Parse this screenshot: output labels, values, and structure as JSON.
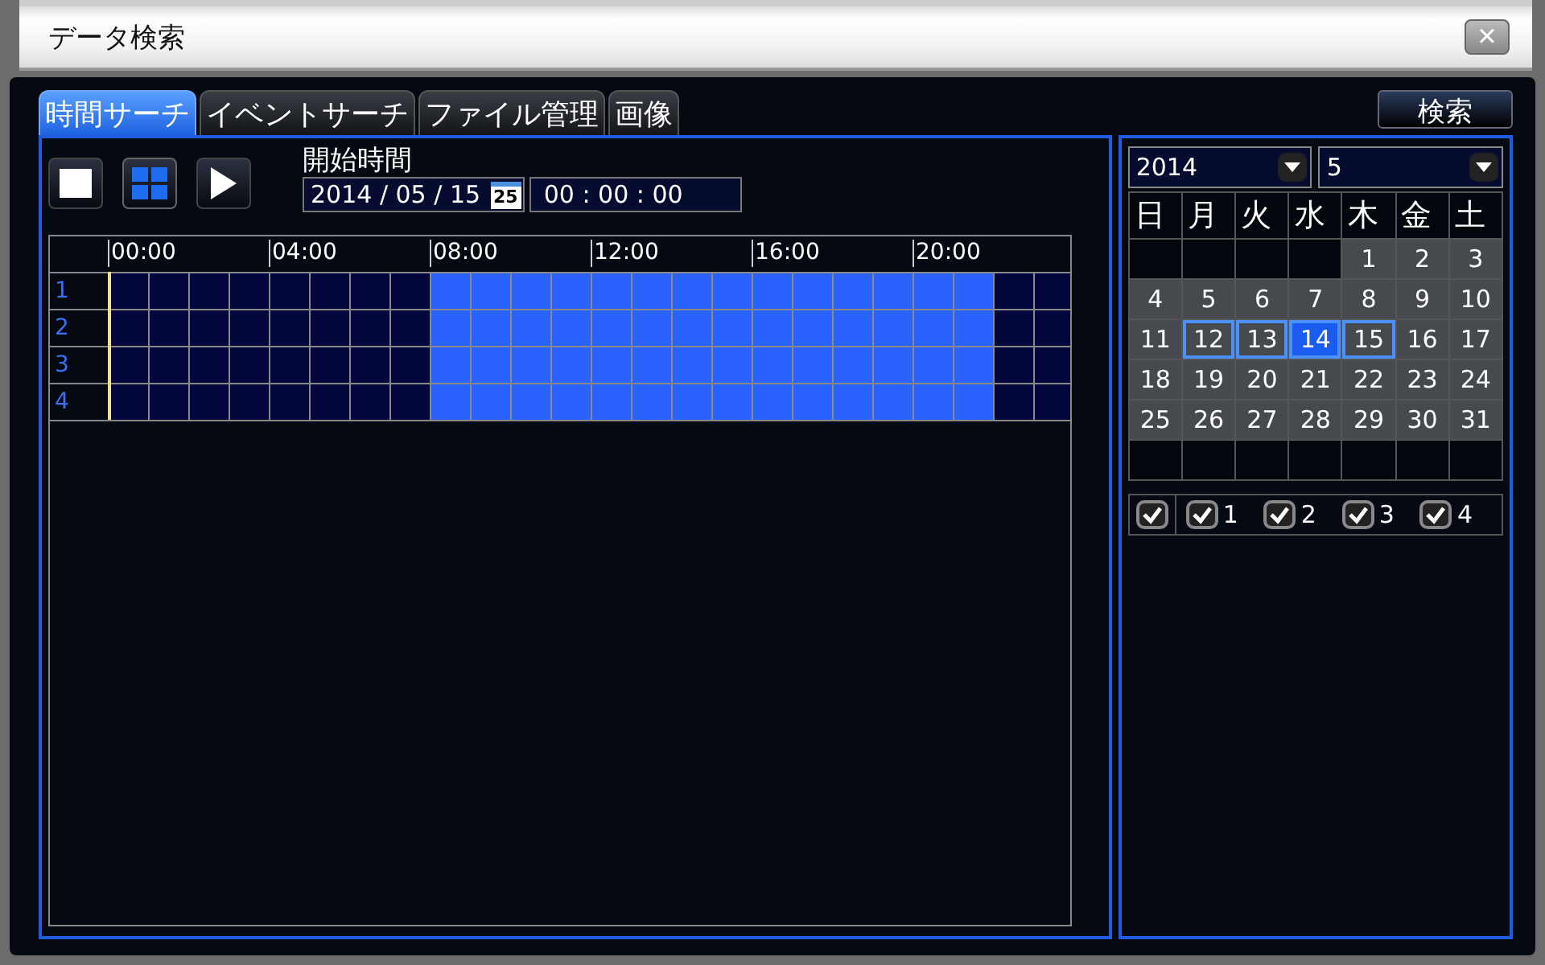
{
  "window": {
    "title": "データ検索",
    "close": "×"
  },
  "tabs": [
    {
      "label": "時間サーチ",
      "selected": true
    },
    {
      "label": "イベントサーチ",
      "selected": false
    },
    {
      "label": "ファイル管理",
      "selected": false
    },
    {
      "label": "画像",
      "selected": false
    }
  ],
  "search_button": "検索",
  "view_buttons": [
    {
      "kind": "single",
      "selected": false
    },
    {
      "kind": "quad",
      "selected": true
    },
    {
      "kind": "play",
      "selected": false
    }
  ],
  "start_time": {
    "label": "開始時間",
    "date": "2014 / 05 / 15",
    "calendar_icon": "25",
    "time": "00 : 00 : 00"
  },
  "timeline": {
    "ticks": [
      "00:00",
      "04:00",
      "08:00",
      "12:00",
      "16:00",
      "20:00"
    ],
    "channels": [
      {
        "label": "1",
        "recorded_hours": [
          false,
          false,
          false,
          false,
          false,
          false,
          false,
          false,
          true,
          true,
          true,
          true,
          true,
          true,
          true,
          true,
          true,
          true,
          true,
          true,
          true,
          true,
          false,
          false
        ]
      },
      {
        "label": "2",
        "recorded_hours": [
          false,
          false,
          false,
          false,
          false,
          false,
          false,
          false,
          true,
          true,
          true,
          true,
          true,
          true,
          true,
          true,
          true,
          true,
          true,
          true,
          true,
          true,
          false,
          false
        ]
      },
      {
        "label": "3",
        "recorded_hours": [
          false,
          false,
          false,
          false,
          false,
          false,
          false,
          false,
          true,
          true,
          true,
          true,
          true,
          true,
          true,
          true,
          true,
          true,
          true,
          true,
          true,
          true,
          false,
          false
        ]
      },
      {
        "label": "4",
        "recorded_hours": [
          false,
          false,
          false,
          false,
          false,
          false,
          false,
          false,
          true,
          true,
          true,
          true,
          true,
          true,
          true,
          true,
          true,
          true,
          true,
          true,
          true,
          true,
          false,
          false
        ]
      }
    ]
  },
  "calendar": {
    "year": "2014",
    "month": "5",
    "weekdays": [
      "日",
      "月",
      "火",
      "水",
      "木",
      "金",
      "土"
    ],
    "days": [
      {
        "label": "1",
        "recorded": true,
        "marked": false,
        "selected": false
      },
      {
        "label": "2",
        "recorded": true,
        "marked": false,
        "selected": false
      },
      {
        "label": "3",
        "recorded": true,
        "marked": false,
        "selected": false
      },
      {
        "label": "4",
        "recorded": true,
        "marked": false,
        "selected": false
      },
      {
        "label": "5",
        "recorded": true,
        "marked": false,
        "selected": false
      },
      {
        "label": "6",
        "recorded": true,
        "marked": false,
        "selected": false
      },
      {
        "label": "7",
        "recorded": true,
        "marked": false,
        "selected": false
      },
      {
        "label": "8",
        "recorded": true,
        "marked": false,
        "selected": false
      },
      {
        "label": "9",
        "recorded": true,
        "marked": false,
        "selected": false
      },
      {
        "label": "10",
        "recorded": true,
        "marked": false,
        "selected": false
      },
      {
        "label": "11",
        "recorded": true,
        "marked": false,
        "selected": false
      },
      {
        "label": "12",
        "recorded": true,
        "marked": true,
        "selected": false
      },
      {
        "label": "13",
        "recorded": true,
        "marked": true,
        "selected": false
      },
      {
        "label": "14",
        "recorded": true,
        "marked": true,
        "selected": true
      },
      {
        "label": "15",
        "recorded": true,
        "marked": true,
        "selected": false
      },
      {
        "label": "16",
        "recorded": true,
        "marked": false,
        "selected": false
      },
      {
        "label": "17",
        "recorded": true,
        "marked": false,
        "selected": false
      },
      {
        "label": "18",
        "recorded": true,
        "marked": false,
        "selected": false
      },
      {
        "label": "19",
        "recorded": true,
        "marked": false,
        "selected": false
      },
      {
        "label": "20",
        "recorded": true,
        "marked": false,
        "selected": false
      },
      {
        "label": "21",
        "recorded": true,
        "marked": false,
        "selected": false
      },
      {
        "label": "22",
        "recorded": true,
        "marked": false,
        "selected": false
      },
      {
        "label": "23",
        "recorded": true,
        "marked": false,
        "selected": false
      },
      {
        "label": "24",
        "recorded": true,
        "marked": false,
        "selected": false
      },
      {
        "label": "25",
        "recorded": true,
        "marked": false,
        "selected": false
      },
      {
        "label": "26",
        "recorded": true,
        "marked": false,
        "selected": false
      },
      {
        "label": "27",
        "recorded": true,
        "marked": false,
        "selected": false
      },
      {
        "label": "28",
        "recorded": true,
        "marked": false,
        "selected": false
      },
      {
        "label": "29",
        "recorded": true,
        "marked": false,
        "selected": false
      },
      {
        "label": "30",
        "recorded": true,
        "marked": false,
        "selected": false
      },
      {
        "label": "31",
        "recorded": true,
        "marked": false,
        "selected": false
      }
    ]
  },
  "channel_checks": [
    {
      "checked": true
    },
    {
      "label": "1",
      "checked": true
    },
    {
      "label": "2",
      "checked": true
    },
    {
      "label": "3",
      "checked": true
    },
    {
      "label": "4",
      "checked": true
    }
  ]
}
